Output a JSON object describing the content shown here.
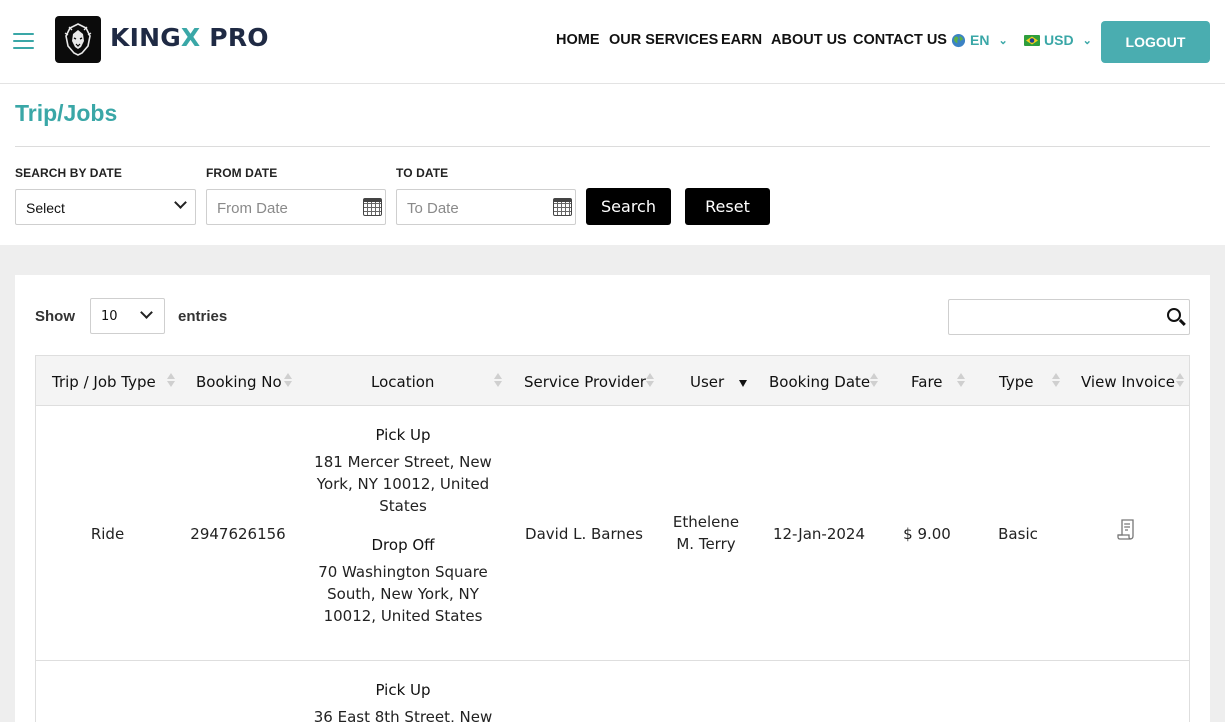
{
  "header": {
    "brand_main": "KING",
    "brand_x": "X",
    "brand_suffix": " PRO",
    "nav": [
      "HOME",
      "OUR SERVICES",
      "EARN",
      "ABOUT US",
      "CONTACT US"
    ],
    "language": "EN",
    "currency": "USD",
    "logout": "LOGOUT"
  },
  "page": {
    "title": "Trip/Jobs"
  },
  "filters": {
    "search_by_date_label": "SEARCH BY DATE",
    "search_by_date_value": "Select",
    "from_date_label": "FROM DATE",
    "from_date_placeholder": "From Date",
    "to_date_label": "TO DATE",
    "to_date_placeholder": "To Date",
    "search_button": "Search",
    "reset_button": "Reset"
  },
  "table_controls": {
    "show_label": "Show",
    "entries_value": "10",
    "entries_label": "entries"
  },
  "table": {
    "columns": [
      "Trip / Job Type",
      "Booking No",
      "Location",
      "Service Provider",
      "User",
      "Booking Date",
      "Fare",
      "Type",
      "View Invoice"
    ],
    "rows": [
      {
        "type": "Ride",
        "booking_no": "2947626156",
        "pickup_label": "Pick Up",
        "pickup_address": "181 Mercer Street, New York, NY 10012, United States",
        "dropoff_label": "Drop Off",
        "dropoff_address": "70 Washington Square South, New York, NY 10012, United States",
        "service_provider": "David L. Barnes",
        "user": "Ethelene M. Terry",
        "booking_date": "12-Jan-2024",
        "fare": "$ 9.00",
        "vehicle_type": "Basic"
      },
      {
        "pickup_label": "Pick Up",
        "pickup_address": "36 East 8th Street, New"
      }
    ]
  },
  "colors": {
    "accent": "#3aa7a7",
    "logout_bg": "#4aadb0",
    "header_text": "#1f2a44",
    "button_black": "#000000",
    "band_gray": "#eeeeee"
  },
  "icons": [
    "menu-icon",
    "lion-logo-icon",
    "globe-icon",
    "flag-icon",
    "chevron-down-icon",
    "calendar-icon",
    "search-icon",
    "sort-icon",
    "invoice-icon"
  ]
}
